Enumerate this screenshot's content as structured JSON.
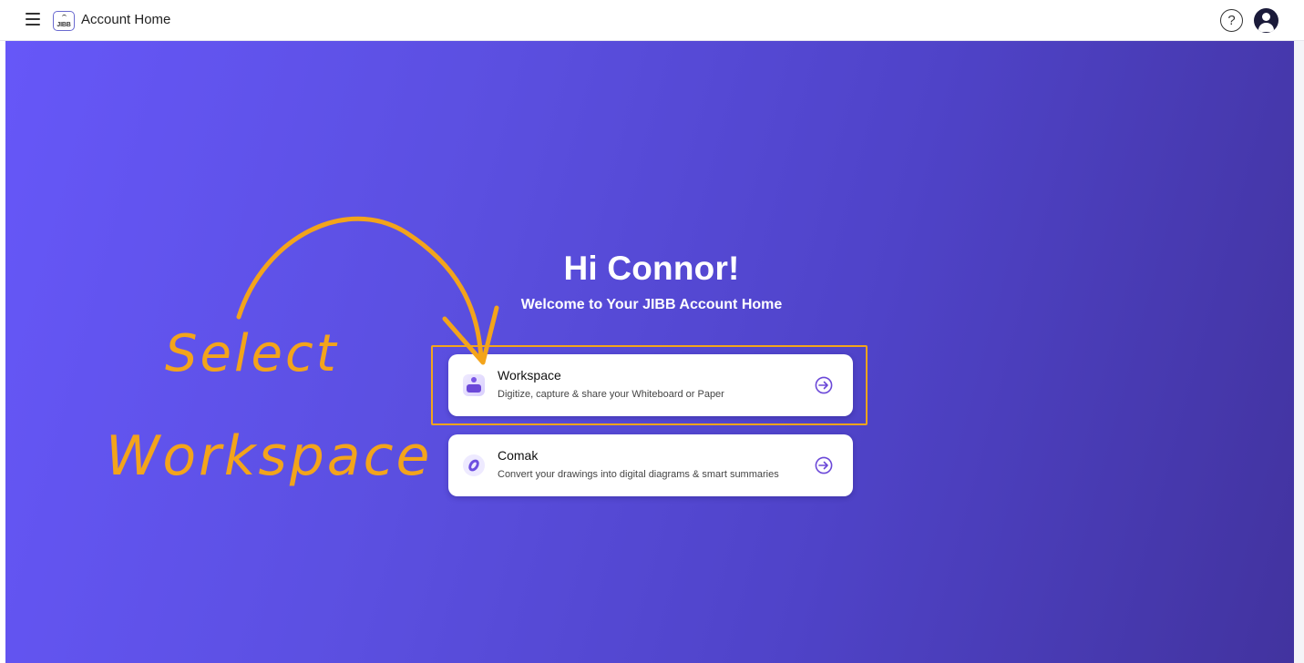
{
  "header": {
    "logo_text": "JIBB",
    "title": "Account Home",
    "help_label": "?",
    "menu_icon": "hamburger-menu-icon",
    "avatar_icon": "user-avatar-icon"
  },
  "hero": {
    "greeting": "Hi Connor!",
    "welcome": "Welcome to Your JIBB Account Home"
  },
  "apps": [
    {
      "title": "Workspace",
      "description": "Digitize, capture & share your Whiteboard or Paper",
      "icon": "workspace-icon",
      "action_icon": "enter-arrow-icon"
    },
    {
      "title": "Comak",
      "description": "Convert your drawings into digital diagrams & smart summaries",
      "icon": "comak-icon",
      "action_icon": "enter-arrow-icon"
    }
  ],
  "annotation": {
    "line1": "Select",
    "line2": "Workspace",
    "color": "#f3a41b"
  },
  "colors": {
    "gradient_start": "#6657f8",
    "gradient_end": "#42339f",
    "accent": "#6b48d8"
  }
}
